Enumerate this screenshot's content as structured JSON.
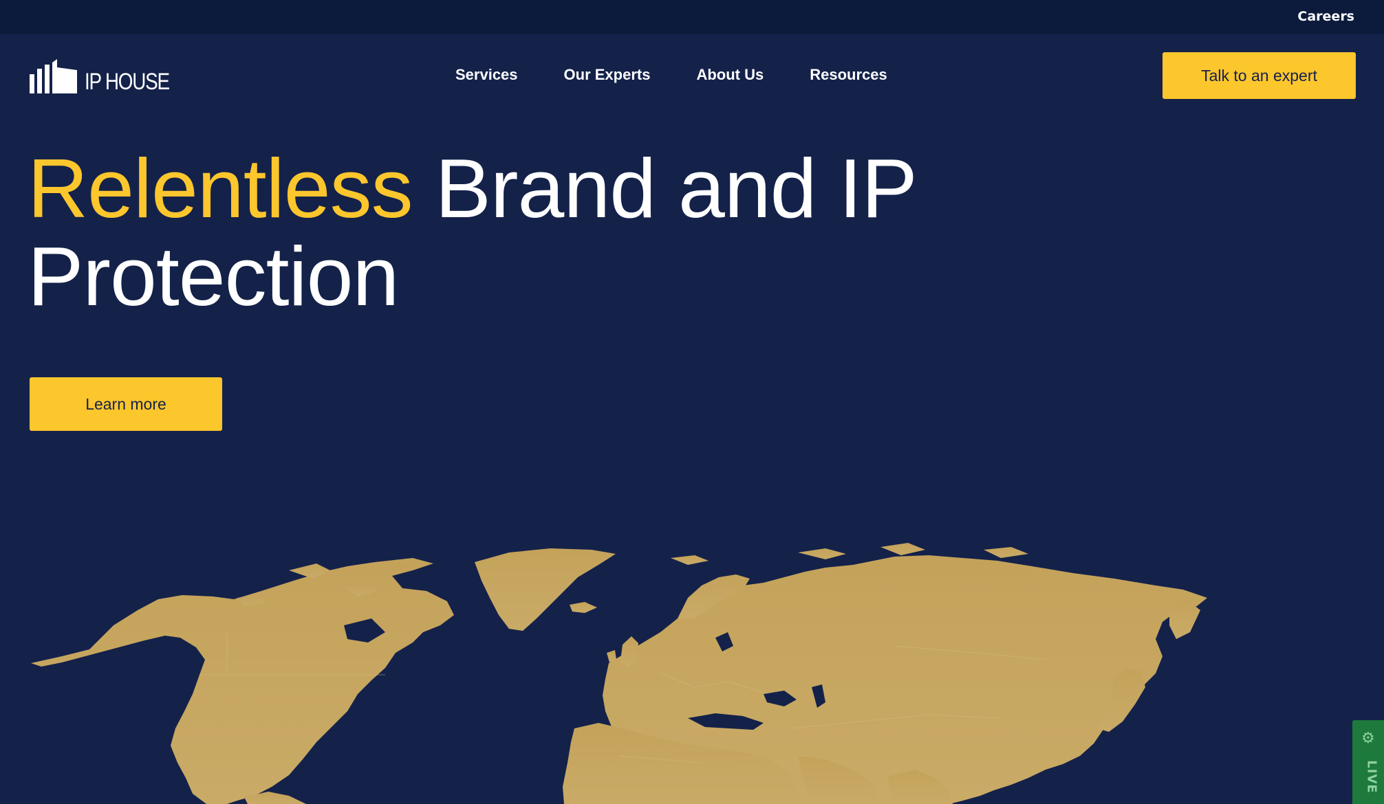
{
  "topbar": {
    "careers_label": "Careers"
  },
  "logo": {
    "text": "IP HOUSE",
    "icon": "ip-house-buildings-icon"
  },
  "nav": {
    "items": [
      {
        "label": "Services"
      },
      {
        "label": "Our Experts"
      },
      {
        "label": "About Us"
      },
      {
        "label": "Resources"
      }
    ],
    "cta_label": "Talk to an expert"
  },
  "hero": {
    "title_accent": "Relentless",
    "title_rest": "Brand and IP Protection",
    "button_label": "Learn more"
  },
  "map": {
    "icon": "world-map-icon"
  },
  "live_widget": {
    "label": "LIVE",
    "icon": "gear-icon"
  },
  "colors": {
    "background": "#14224a",
    "topbar": "#0c1b3c",
    "accent": "#fcc62d",
    "map_land": "#c6a65c",
    "live_green": "#1d7a3c"
  }
}
